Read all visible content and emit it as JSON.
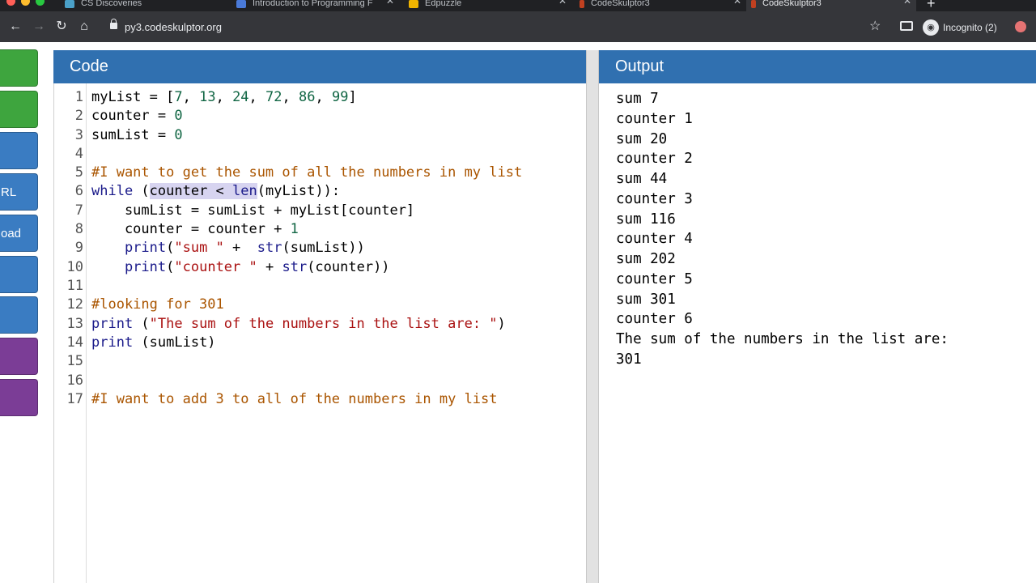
{
  "browser": {
    "tabs": [
      {
        "title": "CS Discoveries",
        "favicon_color": "#4aa0c8"
      },
      {
        "title": "Introduction to Programming F",
        "favicon_color": "#4a7ad8"
      },
      {
        "title": "Edpuzzle",
        "favicon_color": "#f0b400"
      },
      {
        "title": "CodeSkulptor3",
        "favicon_color": "#c04020"
      },
      {
        "title": "CodeSkulptor3",
        "favicon_color": "#c04020",
        "active": true
      }
    ],
    "url": "py3.codeskulptor.org",
    "incognito_label": "Incognito (2)"
  },
  "sidebar": {
    "buttons": [
      {
        "label": "",
        "color": "green"
      },
      {
        "label": "",
        "color": "green"
      },
      {
        "label": "",
        "color": "blue"
      },
      {
        "label": "RL",
        "color": "blue"
      },
      {
        "label": "oad",
        "color": "blue"
      },
      {
        "label": "",
        "color": "blue"
      },
      {
        "label": "",
        "color": "blue"
      },
      {
        "label": "",
        "color": "purple"
      },
      {
        "label": "",
        "color": "purple"
      }
    ]
  },
  "code_panel": {
    "title": "Code",
    "line_numbers": [
      "1",
      "2",
      "3",
      "4",
      "5",
      "6",
      "7",
      "8",
      "9",
      "10",
      "11",
      "12",
      "13",
      "14",
      "15",
      "16",
      "17"
    ],
    "lines": [
      "myList = [7, 13, 24, 72, 86, 99]",
      "counter = 0",
      "sumList = 0",
      "",
      "#I want to get the sum of all the numbers in my list",
      "while (counter < len(myList)):",
      "    sumList = sumList + myList[counter]",
      "    counter = counter + 1",
      "    print(\"sum \" +  str(sumList))",
      "    print(\"counter \" + str(counter))",
      "",
      "#looking for 301",
      "print (\"The sum of the numbers in the list are: \")",
      "print (sumList)",
      "",
      "",
      "#I want to add 3 to all of the numbers in my list"
    ],
    "selected_text": "counter < len"
  },
  "output_panel": {
    "title": "Output",
    "lines": [
      "sum 7",
      "counter 1",
      "sum 20",
      "counter 2",
      "sum 44",
      "counter 3",
      "sum 116",
      "counter 4",
      "sum 202",
      "counter 5",
      "sum 301",
      "counter 6",
      "The sum of the numbers in the list are:",
      "301"
    ]
  }
}
